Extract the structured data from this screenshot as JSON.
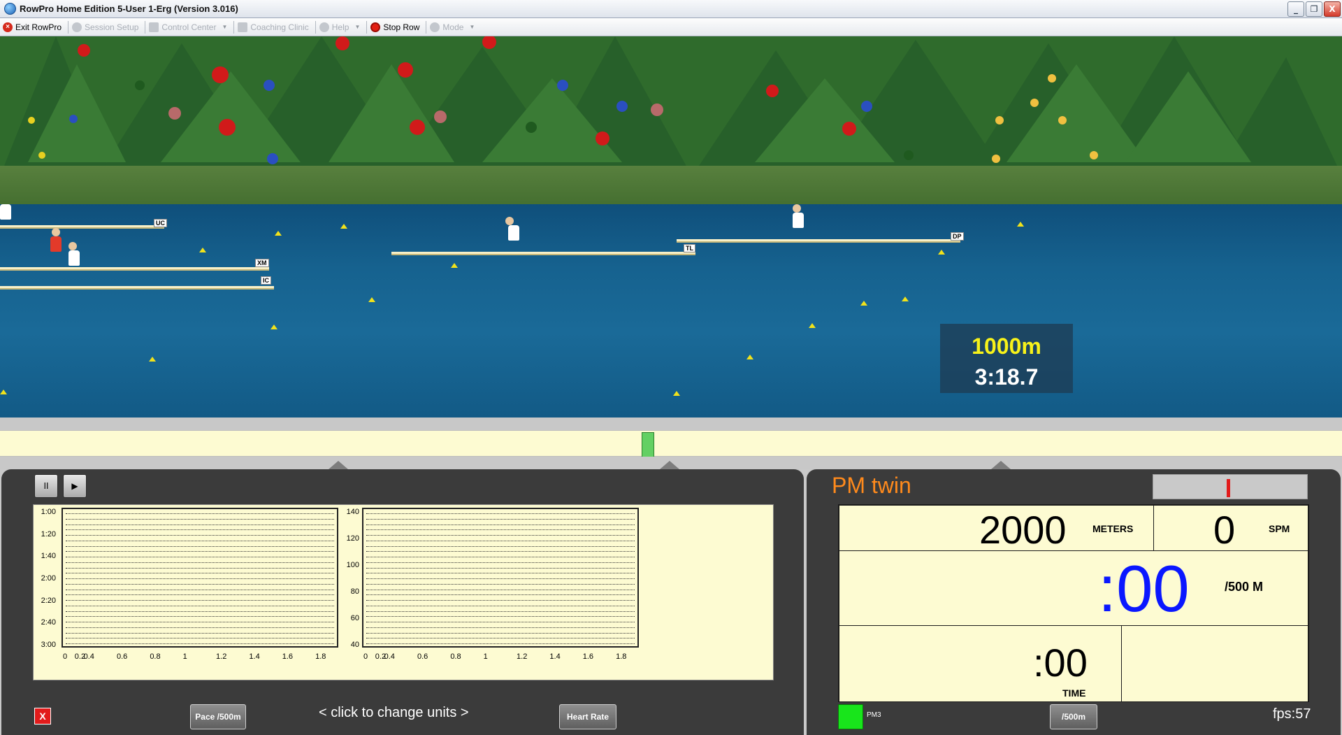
{
  "window": {
    "title": "RowPro Home Edition 5-User 1-Erg  (Version 3.016)",
    "buttons": [
      "_",
      "❐",
      "X"
    ]
  },
  "toolbar": {
    "items": [
      {
        "label": "Exit RowPro",
        "icon": "close-icon",
        "enabled": true
      },
      {
        "label": "Session Setup",
        "icon": "setup-icon",
        "enabled": false
      },
      {
        "label": "Control Center",
        "icon": "control-center-icon",
        "enabled": false
      },
      {
        "label": "Coaching Clinic",
        "icon": "clinic-icon",
        "enabled": false
      },
      {
        "label": "Help",
        "icon": "help-icon",
        "enabled": false
      },
      {
        "label": "Stop Row",
        "icon": "stop-icon",
        "enabled": true
      },
      {
        "label": "Mode",
        "icon": "user-icon",
        "enabled": false
      }
    ]
  },
  "scene": {
    "lane_tags": [
      "UC",
      "XM",
      "IC",
      "TL",
      "DP"
    ],
    "split": {
      "distance": "1000m",
      "time": "3:18.7"
    }
  },
  "colors": {
    "split_distance": "#f7f21a",
    "pm_title": "#ff8a1c",
    "pace_value": "#0a17ff",
    "progress_marker": "#63d063",
    "connected": "#18e51b"
  },
  "graph": {
    "pace_axis": [
      "1:00",
      "1:20",
      "1:40",
      "2:00",
      "2:20",
      "2:40",
      "3:00"
    ],
    "hr_axis": [
      "140",
      "120",
      "100",
      "80",
      "60",
      "40"
    ],
    "x_axis_pace": [
      "0.2",
      "0.4",
      "0.6",
      "0.8",
      "1",
      "1.2",
      "1.4",
      "1.6",
      "1.8"
    ],
    "x_axis_hr": [
      "0.2",
      "0.4",
      "0.6",
      "0.8",
      "1",
      "1.2",
      "1.4",
      "1.6",
      "1.8"
    ],
    "x_axis_prefix": "0"
  },
  "controls": {
    "pause": "II",
    "play": "▶",
    "clear": "X",
    "pace_button": "Pace /500m",
    "units_link": "<  click to change units  >",
    "hr_button": "Heart Rate"
  },
  "monitor": {
    "name": "PM twin",
    "meters_value": "2000",
    "meters_label": "METERS",
    "spm_value": "0",
    "spm_label": "SPM",
    "pace_value": ":00",
    "pace_label": "/500 M",
    "time_value": ":00",
    "time_label": "TIME",
    "device": "PM3",
    "units_button": "/500m",
    "fps": "fps:57"
  }
}
